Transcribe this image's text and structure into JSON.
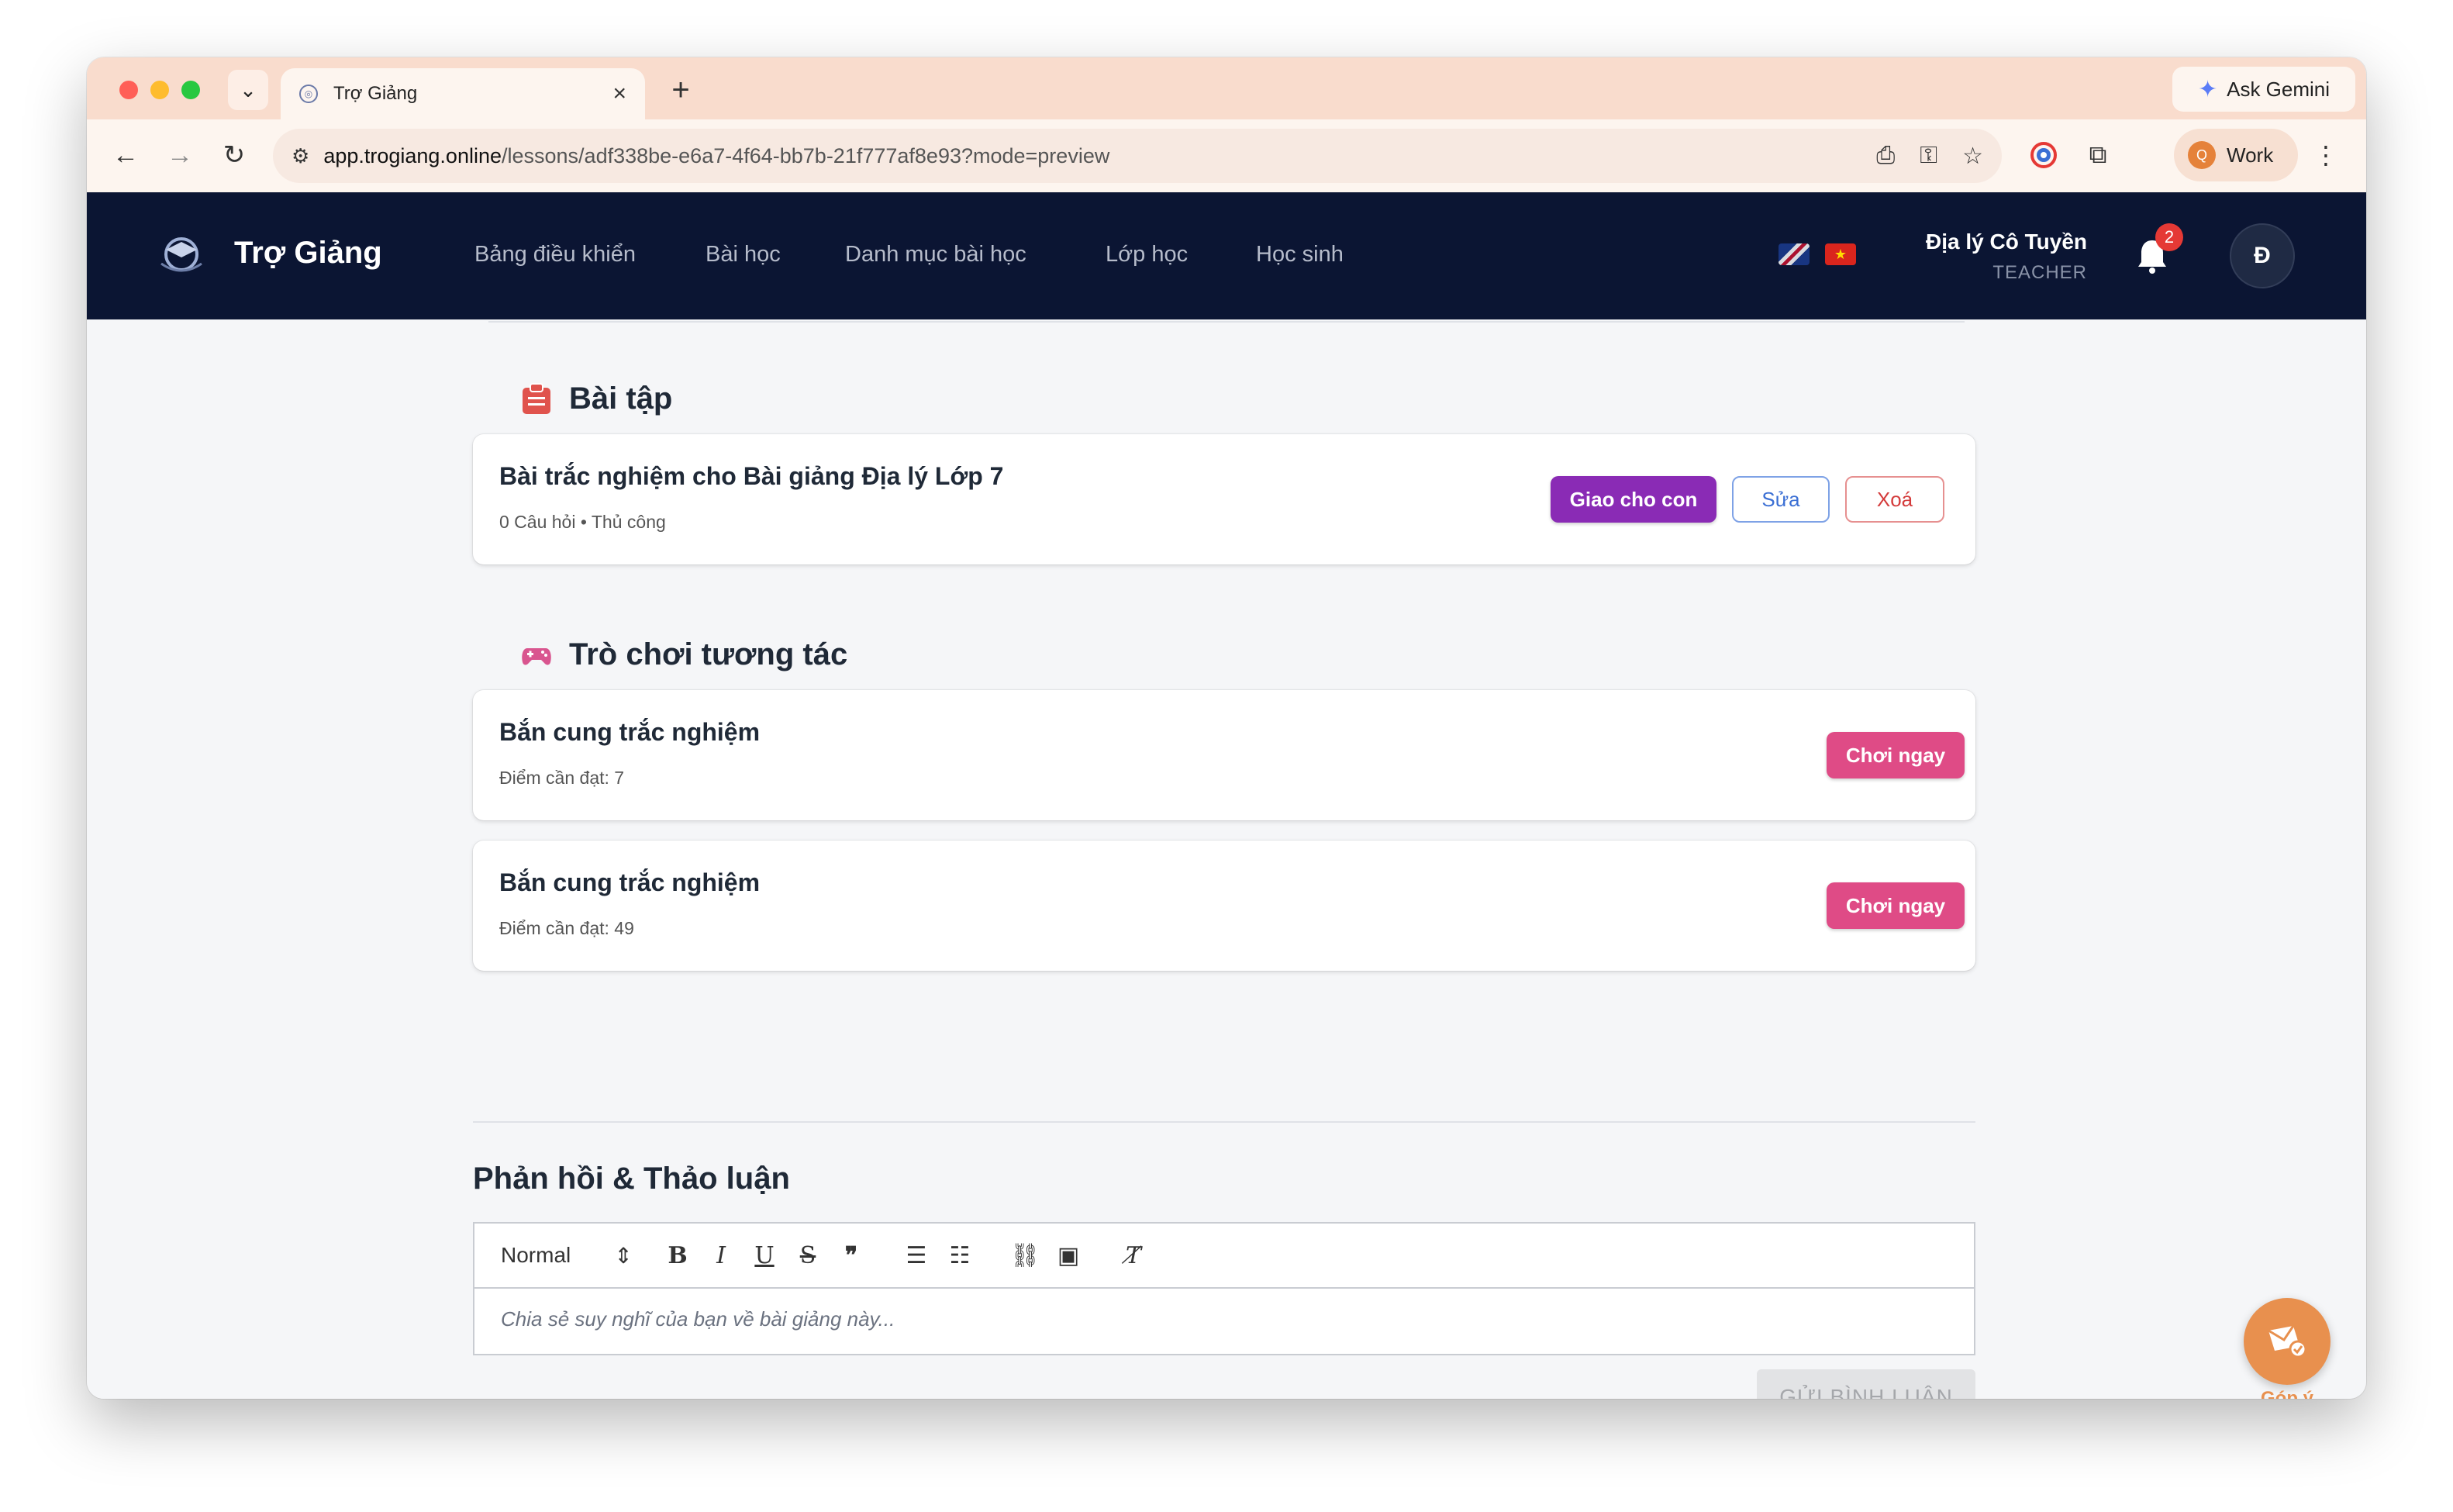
{
  "browser": {
    "tab_title": "Trợ Giảng",
    "new_tab": "+",
    "ask_gemini": "Ask Gemini",
    "url_host": "app.trogiang.online",
    "url_path": "/lessons/adf338be-e6a7-4f64-bb7b-21f777af8e93?mode=preview",
    "profile_initial": "Q",
    "profile_label": "Work"
  },
  "header": {
    "brand": "Trợ Giảng",
    "nav": [
      "Bảng điều khiển",
      "Bài học",
      "Danh mục bài học",
      "Lớp học",
      "Học sinh"
    ],
    "user_name": "Địa lý Cô Tuyền",
    "user_role": "TEACHER",
    "notification_count": "2",
    "avatar_initial": "Đ"
  },
  "exercises": {
    "title": "Bài tập",
    "items": [
      {
        "title": "Bài trắc nghiệm cho Bài giảng Địa lý Lớp 7",
        "meta": "0 Câu hỏi • Thủ công",
        "assign_label": "Giao cho con",
        "edit_label": "Sửa",
        "delete_label": "Xoá"
      }
    ]
  },
  "games": {
    "title": "Trò chơi tương tác",
    "items": [
      {
        "title": "Bắn cung trắc nghiệm",
        "meta": "Điểm cần đạt: 7",
        "play_label": "Chơi ngay"
      },
      {
        "title": "Bắn cung trắc nghiệm",
        "meta": "Điểm cần đạt: 49",
        "play_label": "Chơi ngay"
      }
    ]
  },
  "feedback": {
    "title": "Phản hồi & Thảo luận",
    "format_value": "Normal",
    "placeholder": "Chia sẻ suy nghĩ của bạn về bài giảng này...",
    "submit_label": "GỬI BÌNH LUẬN"
  },
  "fab": {
    "label": "Góp ý"
  },
  "colors": {
    "header_bg": "#0b1533",
    "assign_button": "#8a2bb5",
    "play_button": "#df4b86",
    "fab": "#e8904e"
  },
  "icons": {
    "exercise_section": "clipboard-icon",
    "games_section": "gamepad-icon",
    "notification": "bell-icon",
    "fab": "mail-feedback-icon"
  }
}
